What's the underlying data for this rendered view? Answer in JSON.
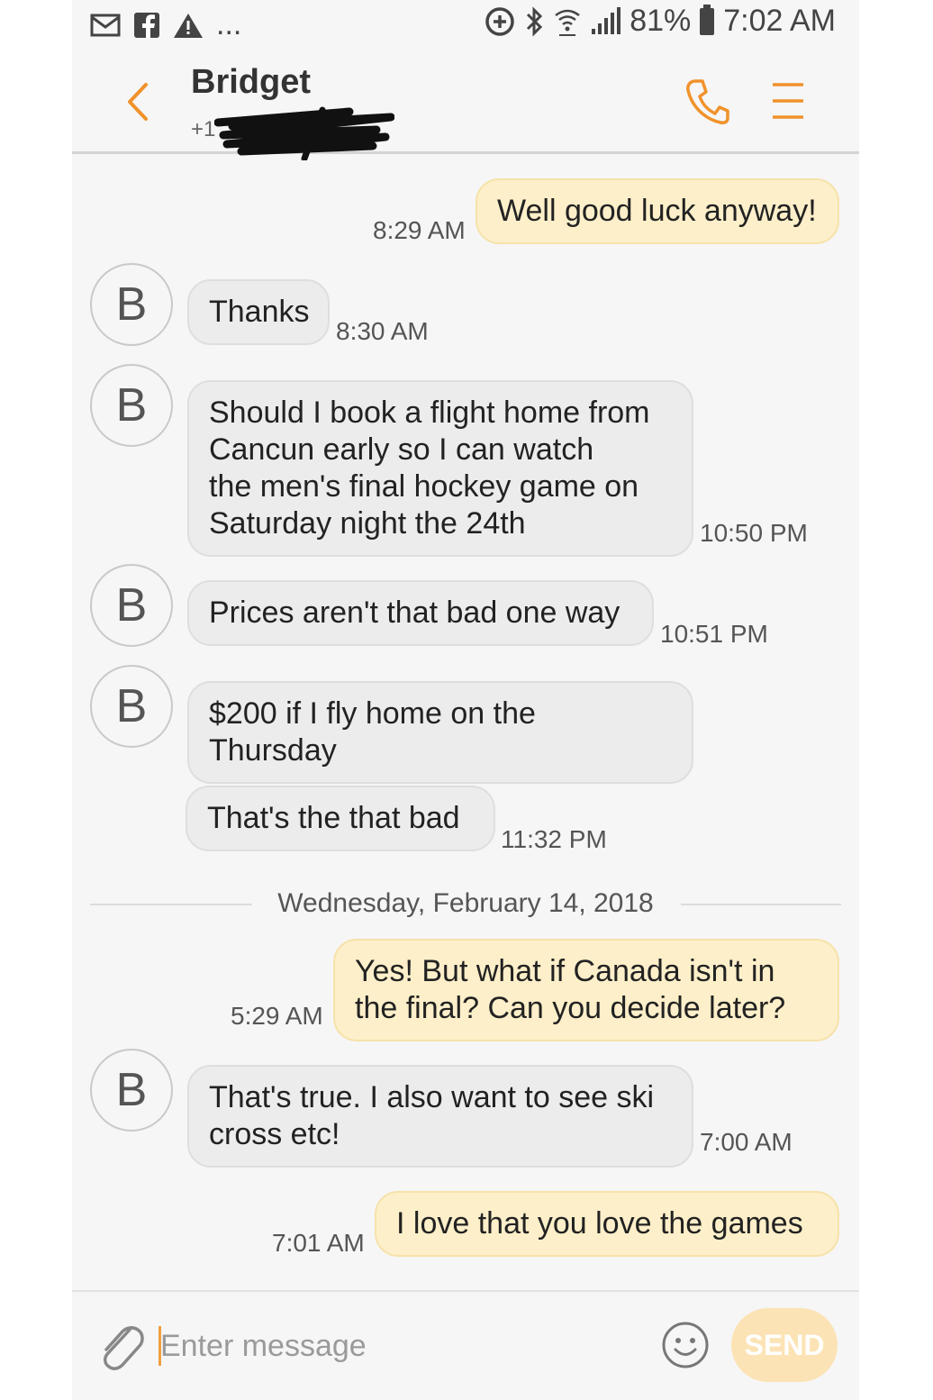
{
  "status_bar": {
    "icons": [
      "mail-icon",
      "facebook-icon",
      "warning-icon",
      "more-icon",
      "data-saver-icon",
      "bluetooth-icon",
      "wifi-icon",
      "signal-icon",
      "battery-icon"
    ],
    "dots": "...",
    "battery": "81%",
    "time": "7:02 AM"
  },
  "header": {
    "contact_name": "Bridget",
    "contact_number": "+1",
    "accent_color": "#f0922b"
  },
  "messages": [
    {
      "dir": "out",
      "text": "Well good luck anyway!",
      "time": "8:29 AM"
    },
    {
      "dir": "in",
      "avatar": "B",
      "text": "Thanks",
      "time": "8:30 AM"
    },
    {
      "dir": "in",
      "avatar": "B",
      "lines": [
        "Should I book a flight home from",
        "Cancun early so I can watch",
        "the men's final hockey game on",
        "Saturday night the 24th"
      ],
      "time": "10:50 PM"
    },
    {
      "dir": "in",
      "avatar": "B",
      "text": "Prices aren't that bad one way",
      "time": "10:51 PM"
    },
    {
      "dir": "in",
      "avatar": "B",
      "lines": [
        "$200 if I fly home on the",
        "Thursday"
      ],
      "time": ""
    },
    {
      "dir": "in",
      "text": "That's the that bad",
      "time": "11:32 PM"
    },
    {
      "dir": "out",
      "lines": [
        "Yes! But what if Canada isn't in",
        "the final? Can you decide later?"
      ],
      "time": "5:29 AM"
    },
    {
      "dir": "in",
      "avatar": "B",
      "lines": [
        "That's true. I also want to see ski",
        "cross etc!"
      ],
      "time": "7:00 AM"
    },
    {
      "dir": "out",
      "text": "I love that you love the games",
      "time": "7:01 AM"
    }
  ],
  "date_separator": "Wednesday, February 14, 2018",
  "composer": {
    "placeholder": "Enter message",
    "send_label": "SEND"
  }
}
